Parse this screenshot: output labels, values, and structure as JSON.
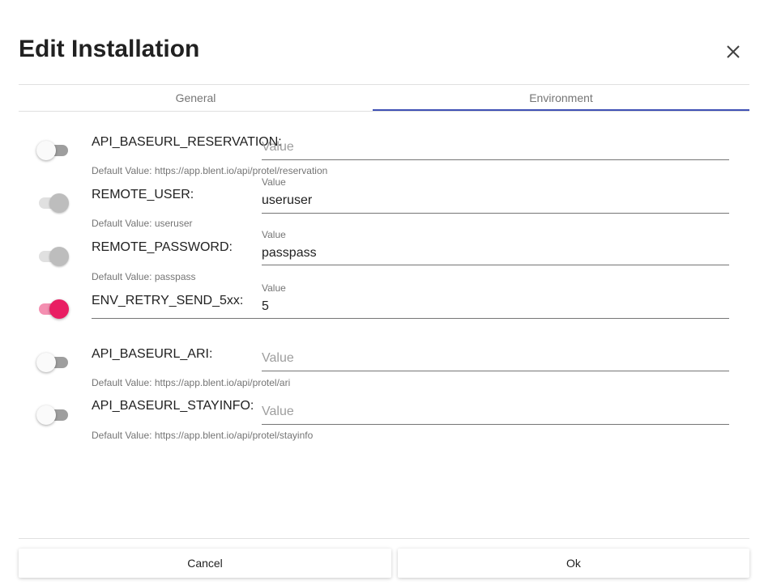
{
  "dialog": {
    "title": "Edit Installation",
    "tabs": [
      {
        "label": "General",
        "active": false
      },
      {
        "label": "Environment",
        "active": true
      }
    ],
    "accent_color": "#3f51b5",
    "toggle_on_color": "#e91e63"
  },
  "env_vars": [
    {
      "name": "API_BASEURL_RESERVATION:",
      "toggle": "off",
      "field_label": "",
      "value": "",
      "placeholder": "Value",
      "default_value": "Default Value: https://app.blent.io/api/protel/reservation"
    },
    {
      "name": "REMOTE_USER:",
      "toggle": "on-disabled",
      "field_label": "Value",
      "value": "useruser",
      "placeholder": "",
      "default_value": "Default Value: useruser"
    },
    {
      "name": "REMOTE_PASSWORD:",
      "toggle": "on-disabled",
      "field_label": "Value",
      "value": "passpass",
      "placeholder": "",
      "default_value": "Default Value: passpass"
    },
    {
      "name": "ENV_RETRY_SEND_5xx:",
      "toggle": "on",
      "field_label": "Value",
      "value": "5",
      "placeholder": "",
      "default_value": ""
    },
    {
      "name": "API_BASEURL_ARI:",
      "toggle": "off",
      "field_label": "",
      "value": "",
      "placeholder": "Value",
      "default_value": "Default Value: https://app.blent.io/api/protel/ari"
    },
    {
      "name": "API_BASEURL_STAYINFO:",
      "toggle": "off",
      "field_label": "",
      "value": "",
      "placeholder": "Value",
      "default_value": "Default Value: https://app.blent.io/api/protel/stayinfo"
    }
  ],
  "footer": {
    "cancel_label": "Cancel",
    "ok_label": "Ok"
  }
}
